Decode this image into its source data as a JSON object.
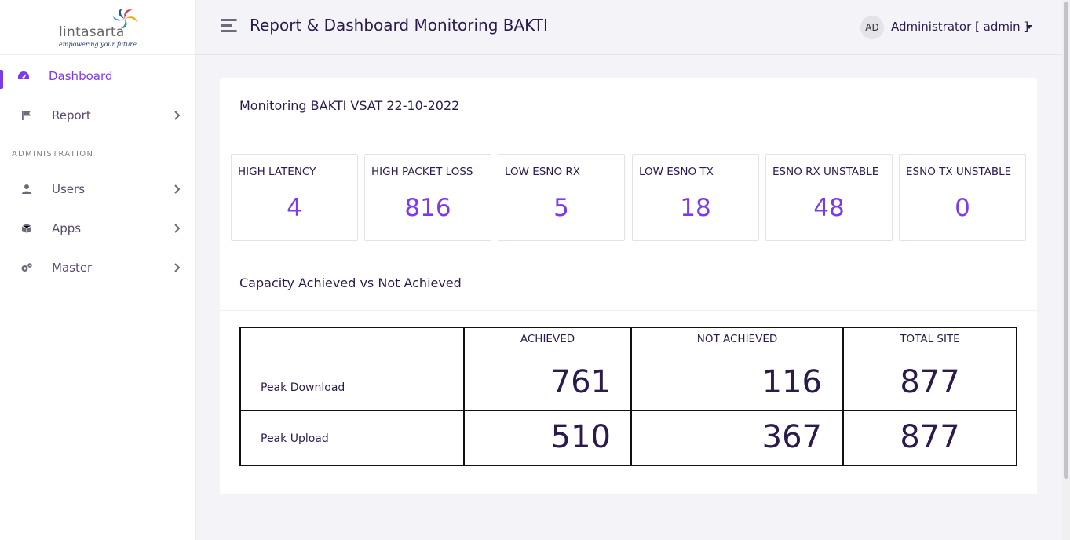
{
  "brand": {
    "name": "lintasarta",
    "tagline": "empowering your future"
  },
  "header": {
    "title": "Report & Dashboard Monitoring BAKTI",
    "avatar_initials": "AD",
    "user_label": "Administrator [ admin ]"
  },
  "sidebar": {
    "items": [
      {
        "label": "Dashboard",
        "icon": "dashboard-gauge-icon",
        "active": true
      },
      {
        "label": "Report",
        "icon": "flag-icon"
      }
    ],
    "section_label": "ADMINISTRATION",
    "admin_items": [
      {
        "label": "Users",
        "icon": "user-icon"
      },
      {
        "label": "Apps",
        "icon": "cube-icon"
      },
      {
        "label": "Master",
        "icon": "gears-icon"
      }
    ]
  },
  "monitoring": {
    "title": "Monitoring BAKTI VSAT 22-10-2022",
    "stats": [
      {
        "label": "HIGH LATENCY",
        "value": "4"
      },
      {
        "label": "HIGH PACKET LOSS",
        "value": "816"
      },
      {
        "label": "LOW ESNO RX",
        "value": "5"
      },
      {
        "label": "LOW ESNO TX",
        "value": "18"
      },
      {
        "label": "ESNO RX UNSTABLE",
        "value": "48"
      },
      {
        "label": "ESNO TX UNSTABLE",
        "value": "0"
      }
    ]
  },
  "capacity": {
    "title": "Capacity Achieved vs Not Achieved",
    "columns": [
      "ACHIEVED",
      "NOT ACHIEVED",
      "TOTAL SITE"
    ],
    "rows": [
      {
        "label": "Peak Download",
        "values": [
          "761",
          "116",
          "877"
        ]
      },
      {
        "label": "Peak Upload",
        "values": [
          "510",
          "367",
          "877"
        ]
      }
    ]
  },
  "colors": {
    "accent": "#7c3aed",
    "text_dark": "#2c1a4d",
    "background": "#f4f4f8"
  }
}
